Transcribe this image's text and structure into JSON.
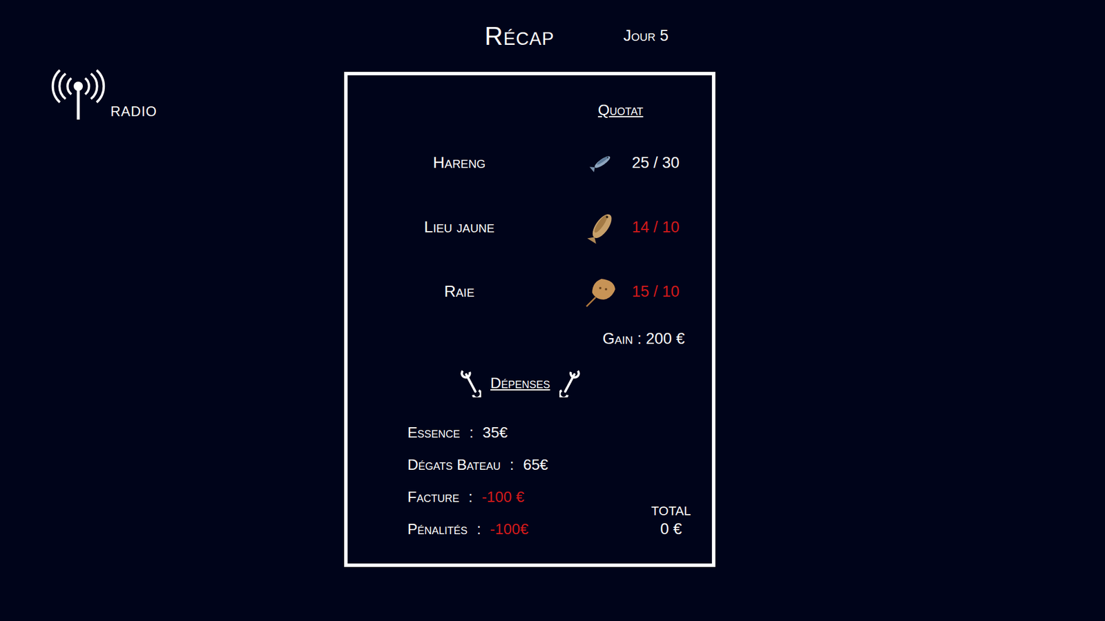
{
  "screen": {
    "title": "Récap",
    "day": "Jour 5"
  },
  "radio": {
    "label": "RADIO"
  },
  "quota": {
    "heading": "Quotat",
    "rows": [
      {
        "name": "Hareng",
        "kind": "herring",
        "count": "25 / 30",
        "over": false
      },
      {
        "name": "Lieu jaune",
        "kind": "pollock",
        "count": "14 / 10",
        "over": true
      },
      {
        "name": "Raie",
        "kind": "ray",
        "count": "15 / 10",
        "over": true
      }
    ],
    "gain": "Gain : 200 €"
  },
  "expenses": {
    "heading": "Dépenses",
    "items": [
      {
        "label": "Essence",
        "separator": ":",
        "value": "35€",
        "negative": false
      },
      {
        "label": "Dégats Bateau",
        "separator": ":",
        "value": "65€",
        "negative": false
      },
      {
        "label": "Facture",
        "separator": ":",
        "value": "-100 €",
        "negative": true
      },
      {
        "label": "Pénalités",
        "separator": ":",
        "value": "-100€",
        "negative": true
      }
    ]
  },
  "total": {
    "label": "TOTAL",
    "value": "0 €"
  }
}
